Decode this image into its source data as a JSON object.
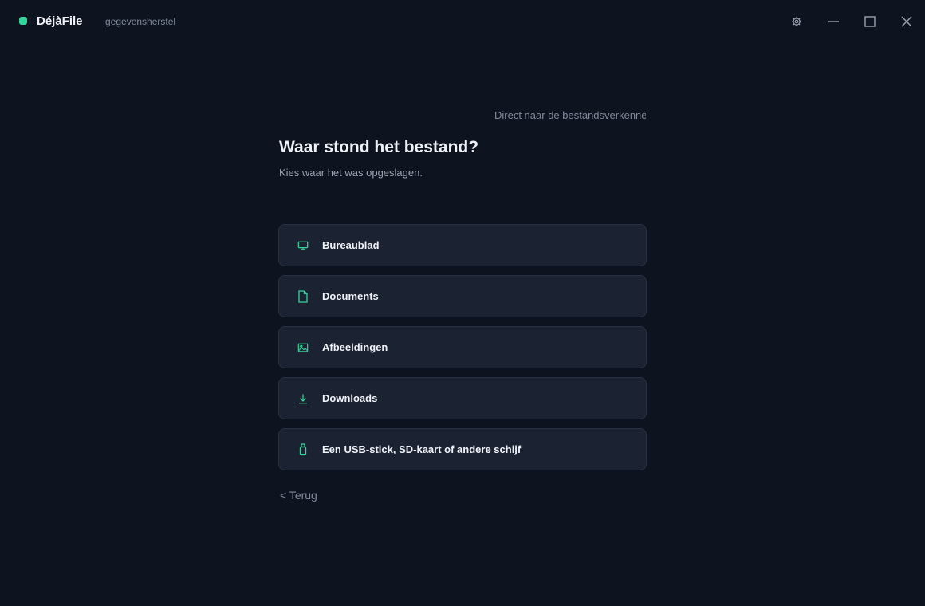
{
  "app": {
    "name": "DéjàFile",
    "subtitle": "gegevensherstel",
    "accent_color": "#34d399"
  },
  "window_controls": {
    "settings_icon": "gear-icon",
    "minimize_icon": "minimize-icon",
    "maximize_icon": "maximize-icon",
    "close_icon": "close-icon"
  },
  "main": {
    "direct_link": "Direct naar de bestandsverkenner",
    "title": "Waar stond het bestand?",
    "subtitle": "Kies waar het was opgeslagen.",
    "options": [
      {
        "label": "Bureaublad",
        "icon": "monitor-icon"
      },
      {
        "label": "Documents",
        "icon": "document-icon"
      },
      {
        "label": "Afbeeldingen",
        "icon": "image-icon"
      },
      {
        "label": "Downloads",
        "icon": "download-icon"
      },
      {
        "label": "Een USB-stick, SD-kaart of andere schijf",
        "icon": "usb-drive-icon"
      }
    ],
    "back_label": "< Terug"
  }
}
